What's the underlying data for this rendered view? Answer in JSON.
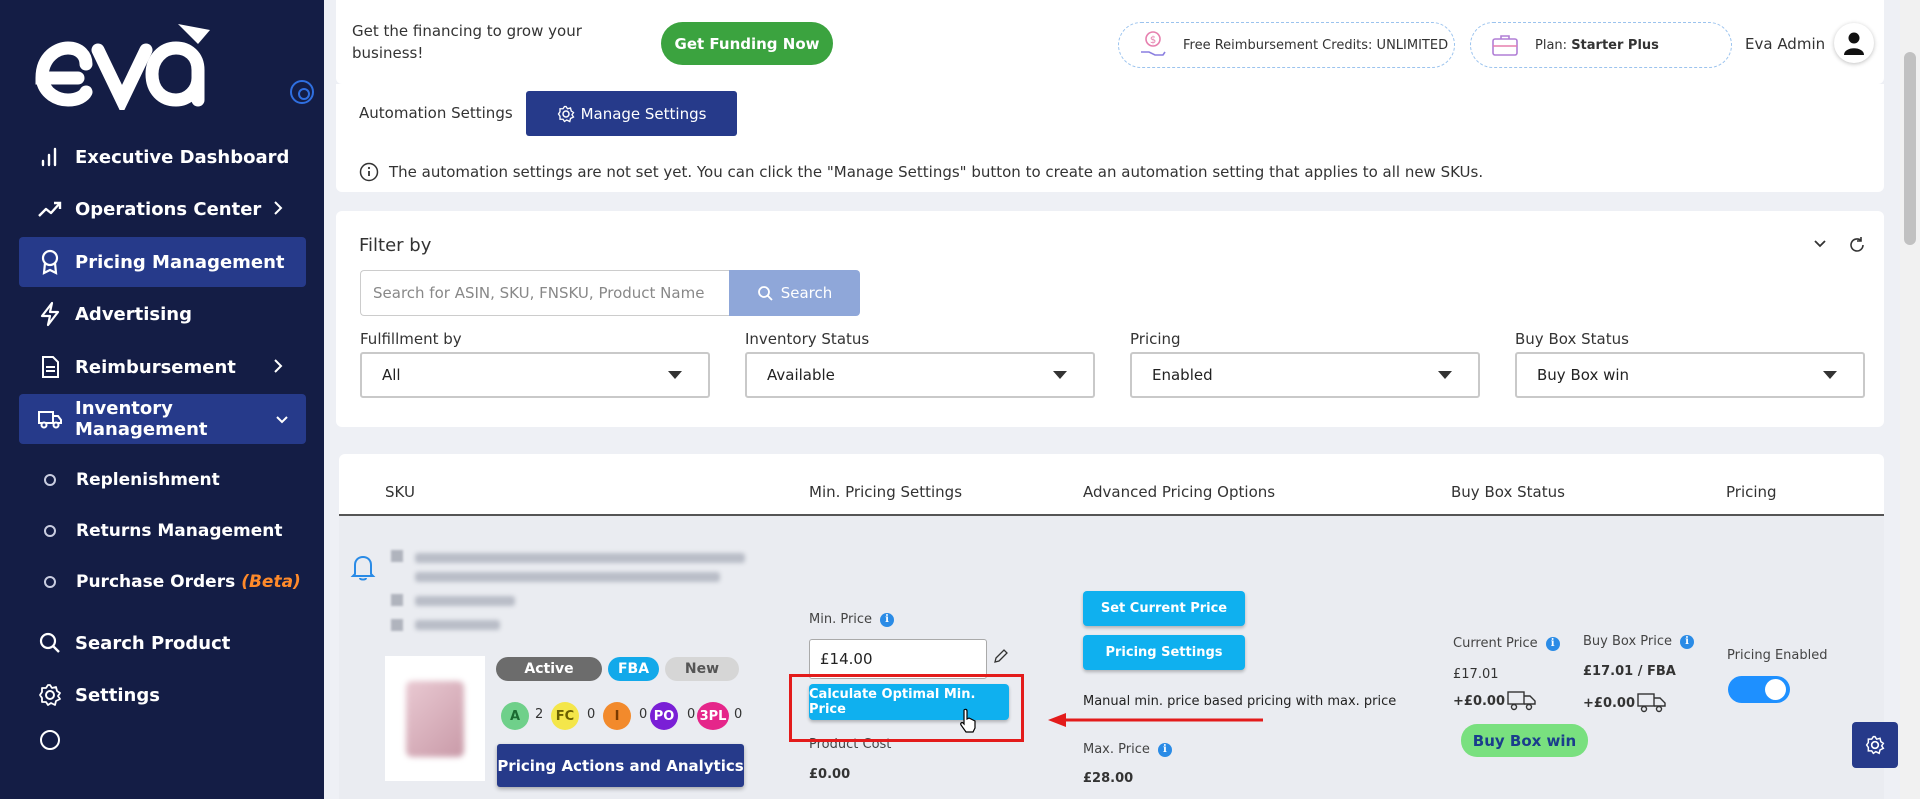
{
  "sidebar": {
    "logo_text": "eva",
    "items": [
      {
        "label": "Executive Dashboard",
        "icon": "bar-chart-icon"
      },
      {
        "label": "Operations Center",
        "icon": "trend-icon"
      },
      {
        "label": "Pricing Management",
        "icon": "award-icon"
      },
      {
        "label": "Advertising",
        "icon": "lightning-icon"
      },
      {
        "label": "Reimbursement",
        "icon": "document-icon"
      },
      {
        "label": "Inventory Management",
        "icon": "truck-icon"
      }
    ],
    "sub_items": [
      {
        "label": "Replenishment"
      },
      {
        "label": "Returns Management"
      },
      {
        "label": "Purchase Orders",
        "tag": "(Beta)"
      }
    ],
    "search_product": "Search Product",
    "settings": "Settings"
  },
  "topbar": {
    "funding_text": "Get the financing to grow your business!",
    "funding_button": "Get Funding Now",
    "credits_text": "Free Reimbursement Credits: UNLIMITED",
    "plan_label": "Plan:",
    "plan_value": "Starter Plus",
    "admin_name": "Eva Admin"
  },
  "automation": {
    "label": "Automation Settings",
    "manage_button": "Manage Settings",
    "info_text": "The automation settings are not set yet. You can click the \"Manage Settings\" button to create an automation setting that applies to all new SKUs."
  },
  "filter": {
    "title": "Filter by",
    "search_placeholder": "Search for ASIN, SKU, FNSKU, Product Name",
    "search_button": "Search",
    "fields": [
      {
        "label": "Fulfillment by",
        "value": "All"
      },
      {
        "label": "Inventory Status",
        "value": "Available"
      },
      {
        "label": "Pricing",
        "value": "Enabled"
      },
      {
        "label": "Buy Box Status",
        "value": "Buy Box win"
      }
    ]
  },
  "table": {
    "headers": [
      "SKU",
      "Min. Pricing Settings",
      "Advanced Pricing Options",
      "Buy Box Status",
      "Pricing"
    ],
    "row": {
      "badges": [
        "Active",
        "FBA",
        "New"
      ],
      "counts": [
        {
          "label": "A",
          "count": "2",
          "color": "#6fd08a"
        },
        {
          "label": "FC",
          "count": "0",
          "color": "#f4e64a"
        },
        {
          "label": "I",
          "count": "0",
          "color": "#f28a2c"
        },
        {
          "label": "PO",
          "count": "0",
          "color": "#7a1fd6"
        },
        {
          "label": "3PL",
          "count": "0",
          "color": "#e5268a"
        }
      ],
      "actions_button": "Pricing Actions and Analytics",
      "min_price_label": "Min. Price",
      "min_price_value": "£14.00",
      "calc_button": "Calculate Optimal Min. Price",
      "product_cost_label": "Product Cost",
      "product_cost_value": "£0.00",
      "set_current_price_button": "Set Current Price",
      "pricing_settings_button": "Pricing Settings",
      "pricing_desc": "Manual min. price based pricing with max. price",
      "max_price_label": "Max. Price",
      "max_price_value": "£28.00",
      "current_price_label": "Current Price",
      "current_price_value": "£17.01",
      "current_price_ship": "+£0.00",
      "buybox_price_label": "Buy Box Price",
      "buybox_price_value": "£17.01 / FBA",
      "buybox_price_ship": "+£0.00",
      "buybox_status": "Buy Box win",
      "pricing_enabled_label": "Pricing Enabled",
      "pricing_enabled": true
    }
  },
  "colors": {
    "sidebar_bg": "#141d45",
    "active_nav": "#263a8a",
    "funding_green": "#3ba33f",
    "cyan_button": "#0fb0ef",
    "annotation_red": "#e31b1b"
  }
}
